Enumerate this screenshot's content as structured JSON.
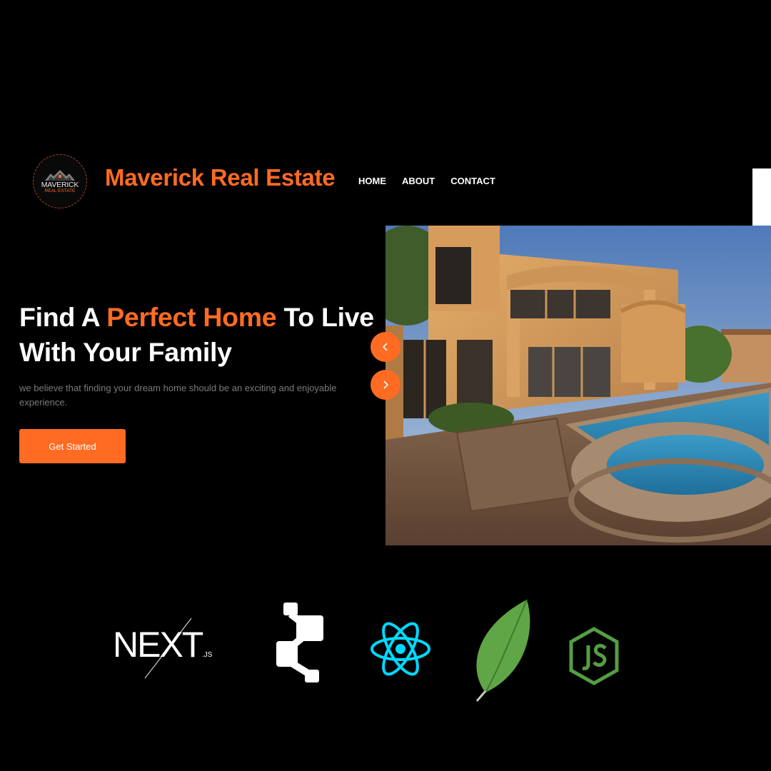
{
  "brand": {
    "logo_line1": "MAVERICK",
    "logo_line2": "REAL ESTATE",
    "name": "Maverick Real Estate"
  },
  "nav": {
    "items": [
      "HOME",
      "ABOUT",
      "CONTACT"
    ]
  },
  "hero": {
    "title_part1": "Find A ",
    "title_highlight": "Perfect Home",
    "title_part2": " To Live With Your Family",
    "subtitle": "we believe that finding your dream home should be an exciting and enjoyable experience.",
    "cta_label": "Get Started"
  },
  "tech_stack": {
    "next_label": "NEXT",
    "next_suffix": ".JS",
    "icons": [
      "nextjs-icon",
      "prisma-icon",
      "react-icon",
      "mongodb-icon",
      "nodejs-icon"
    ]
  },
  "colors": {
    "accent": "#ff6b22",
    "background": "#000000",
    "react": "#00d8ff",
    "mongo": "#5fa646",
    "node": "#539e43"
  }
}
